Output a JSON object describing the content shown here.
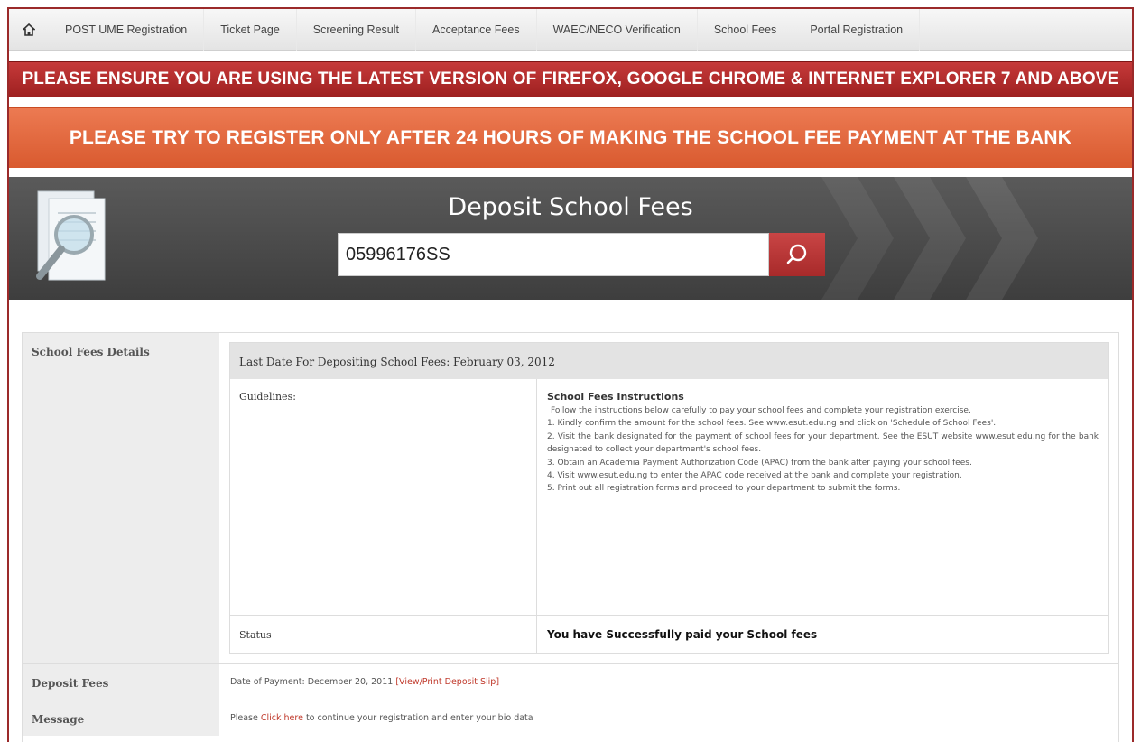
{
  "nav": {
    "items": [
      "POST UME Registration",
      "Ticket Page",
      "Screening Result",
      "Acceptance Fees",
      "WAEC/NECO Verification",
      "School Fees",
      "Portal Registration"
    ]
  },
  "banners": {
    "browser_notice": "PLEASE ENSURE YOU ARE USING THE LATEST VERSION OF FIREFOX, GOOGLE CHROME & INTERNET EXPLORER 7 AND ABOVE",
    "register_notice": "PLEASE TRY TO REGISTER ONLY AFTER 24 HOURS OF MAKING THE SCHOOL FEE PAYMENT AT THE BANK"
  },
  "search": {
    "title": "Deposit School Fees",
    "value": "05996176SS"
  },
  "details": {
    "label": "School Fees Details",
    "last_date": "Last Date For Depositing School Fees: February 03, 2012",
    "guidelines_label": "Guidelines:",
    "instructions_title": "School Fees Instructions",
    "instructions_intro": "Follow the instructions below carefully to pay your school fees and complete your registration exercise.",
    "steps": [
      "1. Kindly confirm the amount for the school fees. See www.esut.edu.ng and click on 'Schedule of School Fees'.",
      "2. Visit the bank designated for the payment of school fees for your department. See the ESUT website www.esut.edu.ng for the bank designated to collect your department's school fees.",
      "3. Obtain an Academia Payment Authorization Code (APAC) from the bank after paying your school fees.",
      "4. Visit www.esut.edu.ng to enter the APAC code received at the bank and complete your registration.",
      "5. Print out all registration forms and proceed to your department to submit the forms."
    ],
    "status_label": "Status",
    "status_value": "You have Successfully paid your School fees"
  },
  "deposit": {
    "label": "Deposit Fees",
    "date_text": "Date of Payment: December 20, 2011 ",
    "link": "[View/Print Deposit Slip]"
  },
  "message": {
    "label": "Message",
    "prefix": "Please ",
    "link": "Click here",
    "suffix": " to continue your registration and enter your bio data"
  },
  "colors": {
    "accent_red": "#a82a2a",
    "banner_orange": "#d95a2f",
    "link": "#c0392b"
  }
}
